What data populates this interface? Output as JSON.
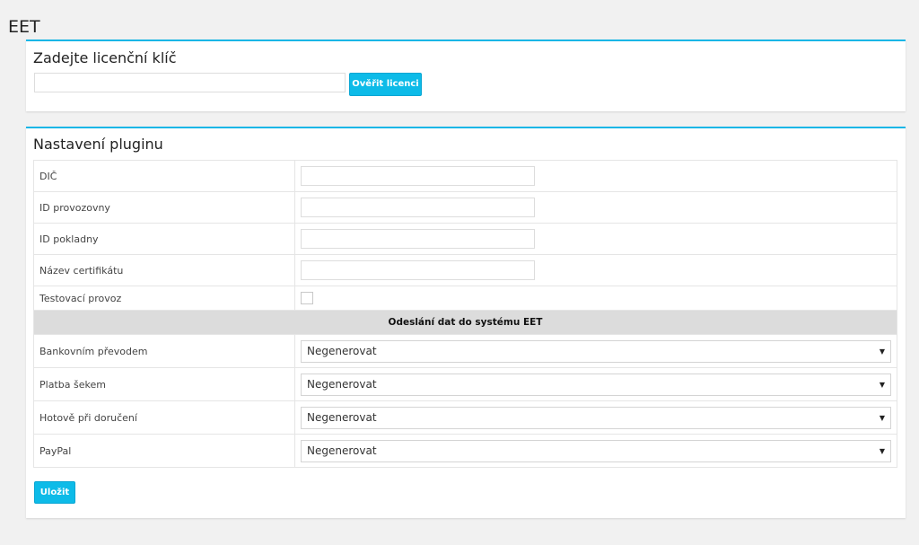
{
  "page": {
    "title": "EET"
  },
  "license": {
    "heading": "Zadejte licenční klíč",
    "input_value": "",
    "verify_label": "Ověřit licenci"
  },
  "settings": {
    "heading": "Nastavení pluginu",
    "fields": [
      {
        "label": "DIČ",
        "value": ""
      },
      {
        "label": "ID provozovny",
        "value": ""
      },
      {
        "label": "ID pokladny",
        "value": ""
      },
      {
        "label": "Název certifikátu",
        "value": ""
      }
    ],
    "test_mode": {
      "label": "Testovací provoz",
      "checked": false
    },
    "section_title": "Odeslání dat do systému EET",
    "payment_methods": [
      {
        "label": "Bankovním převodem",
        "selected": "Negenerovat"
      },
      {
        "label": "Platba šekem",
        "selected": "Negenerovat"
      },
      {
        "label": "Hotově při doručení",
        "selected": "Negenerovat"
      },
      {
        "label": "PayPal",
        "selected": "Negenerovat"
      }
    ],
    "save_label": "Uložit"
  }
}
